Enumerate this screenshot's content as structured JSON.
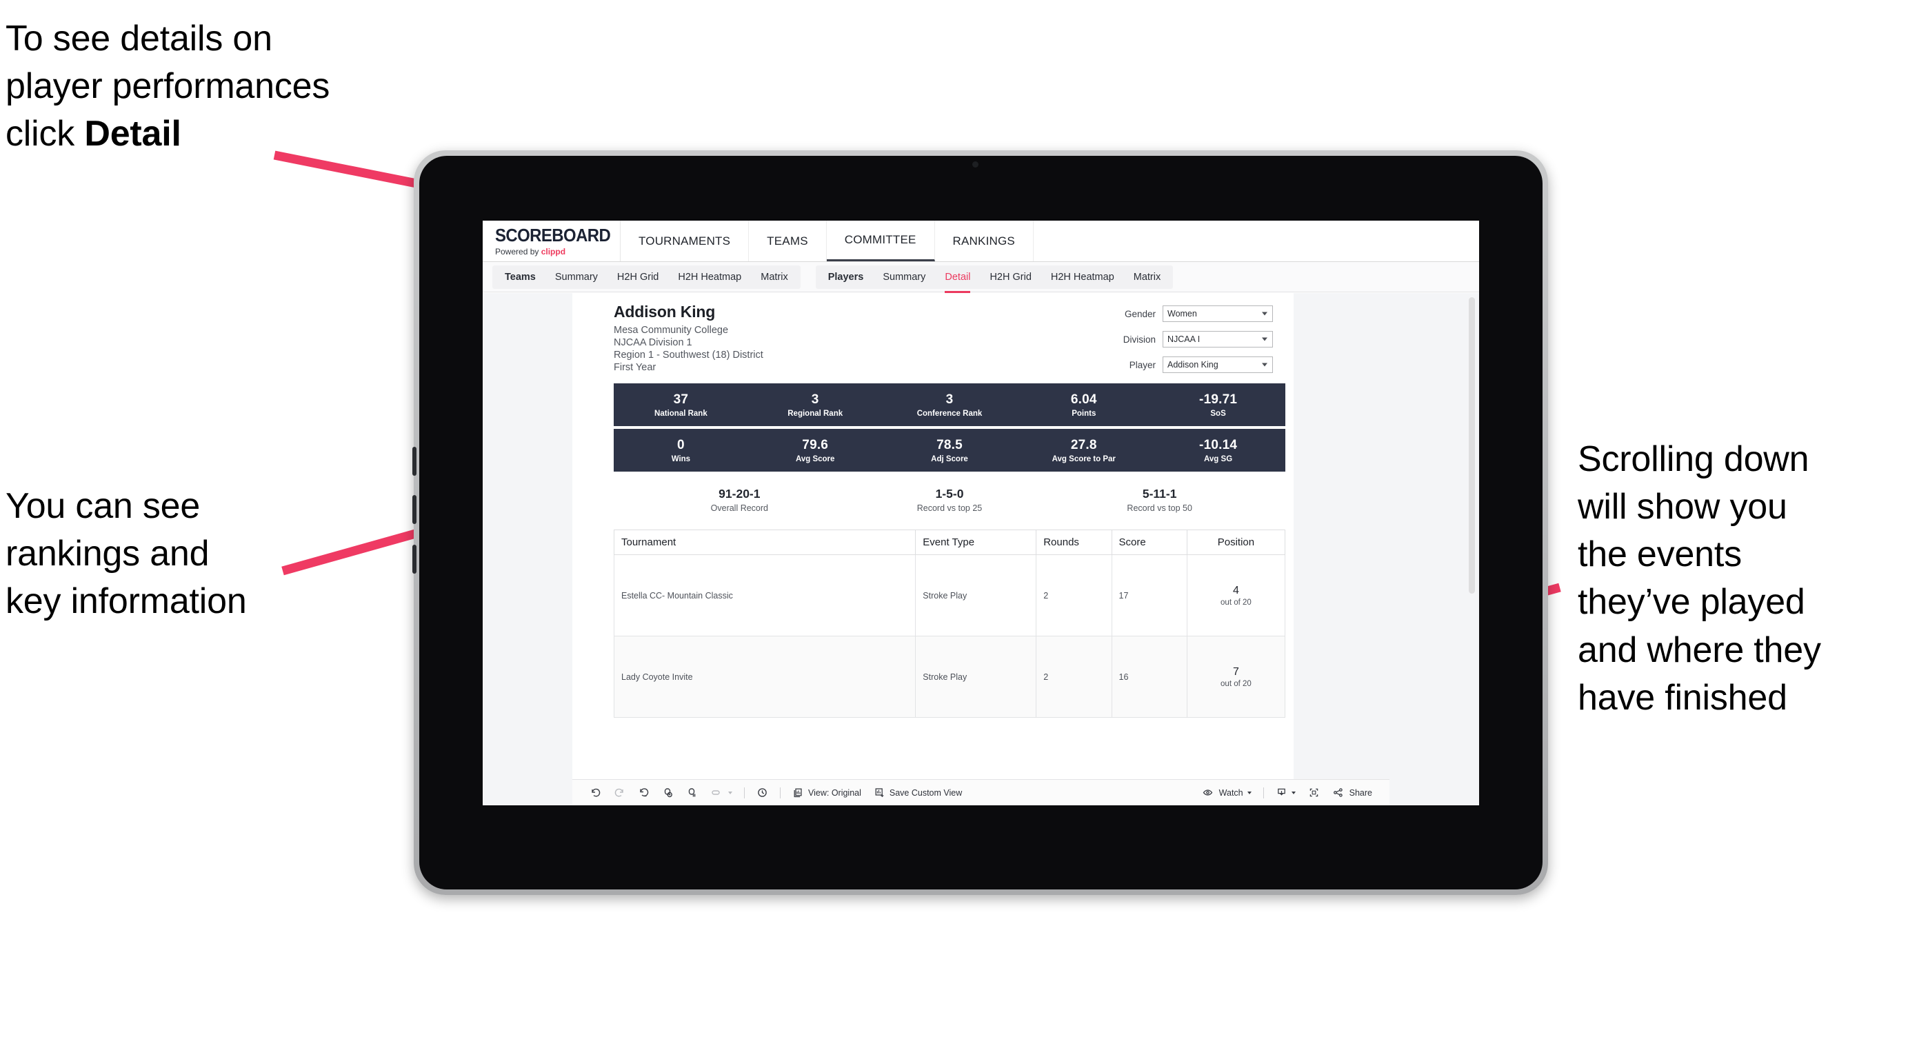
{
  "annotations": {
    "top_left_part1": "To see details on\nplayer performances\nclick ",
    "top_left_bold": "Detail",
    "mid_left": "You can see\nrankings and\nkey information",
    "right": "Scrolling down\nwill show you\nthe events\nthey’ve played\nand where they\nhave finished"
  },
  "colors": {
    "accent_pink": "#ec3a5f",
    "arrow_pink": "#ef3a63",
    "navy": "#2e3447",
    "brand_red": "#ee3a5d"
  },
  "app": {
    "brand": {
      "title": "SCOREBOARD",
      "powered_prefix": "Powered by ",
      "powered_name": "clippd"
    },
    "top_nav": [
      {
        "label": "TOURNAMENTS",
        "selected": false
      },
      {
        "label": "TEAMS",
        "selected": false
      },
      {
        "label": "COMMITTEE",
        "selected": true
      },
      {
        "label": "RANKINGS",
        "selected": false
      }
    ],
    "tab_groups": [
      {
        "head": "Teams",
        "tabs": [
          {
            "label": "Summary",
            "active": false
          },
          {
            "label": "H2H Grid",
            "active": false
          },
          {
            "label": "H2H Heatmap",
            "active": false
          },
          {
            "label": "Matrix",
            "active": false
          }
        ]
      },
      {
        "head": "Players",
        "tabs": [
          {
            "label": "Summary",
            "active": false
          },
          {
            "label": "Detail",
            "active": true
          },
          {
            "label": "H2H Grid",
            "active": false
          },
          {
            "label": "H2H Heatmap",
            "active": false
          },
          {
            "label": "Matrix",
            "active": false
          }
        ]
      }
    ]
  },
  "player": {
    "name": "Addison King",
    "school": "Mesa Community College",
    "division": "NJCAA Division 1",
    "region": "Region 1 - Southwest (18) District",
    "year": "First Year"
  },
  "filters": [
    {
      "label": "Gender",
      "value": "Women"
    },
    {
      "label": "Division",
      "value": "NJCAA I"
    },
    {
      "label": "Player",
      "value": "Addison King"
    }
  ],
  "stats_row1": [
    {
      "value": "37",
      "label": "National Rank"
    },
    {
      "value": "3",
      "label": "Regional Rank"
    },
    {
      "value": "3",
      "label": "Conference Rank"
    },
    {
      "value": "6.04",
      "label": "Points"
    },
    {
      "value": "-19.71",
      "label": "SoS"
    }
  ],
  "stats_row2": [
    {
      "value": "0",
      "label": "Wins"
    },
    {
      "value": "79.6",
      "label": "Avg Score"
    },
    {
      "value": "78.5",
      "label": "Adj Score"
    },
    {
      "value": "27.8",
      "label": "Avg Score to Par"
    },
    {
      "value": "-10.14",
      "label": "Avg SG"
    }
  ],
  "records": [
    {
      "value": "91-20-1",
      "label": "Overall Record"
    },
    {
      "value": "1-5-0",
      "label": "Record vs top 25"
    },
    {
      "value": "5-11-1",
      "label": "Record vs top 50"
    }
  ],
  "events_table": {
    "headers": [
      "Tournament",
      "Event Type",
      "Rounds",
      "Score",
      "Position"
    ],
    "rows": [
      {
        "tournament": "Estella CC- Mountain Classic",
        "event_type": "Stroke Play",
        "rounds": "2",
        "score": "17",
        "position": "4",
        "position_of": "out of 20"
      },
      {
        "tournament": "Lady Coyote Invite",
        "event_type": "Stroke Play",
        "rounds": "2",
        "score": "16",
        "position": "7",
        "position_of": "out of 20"
      }
    ]
  },
  "toolbar": {
    "view_label": "View: Original",
    "save_label": "Save Custom View",
    "watch_label": "Watch",
    "share_label": "Share",
    "icons": [
      "undo-icon",
      "redo-icon",
      "revert-icon",
      "refresh-icon",
      "pause-icon",
      "highlight-icon",
      "clock-icon",
      "view-icon",
      "save-view-icon",
      "eye-icon",
      "download-icon",
      "fullscreen-icon",
      "share-icon"
    ]
  }
}
